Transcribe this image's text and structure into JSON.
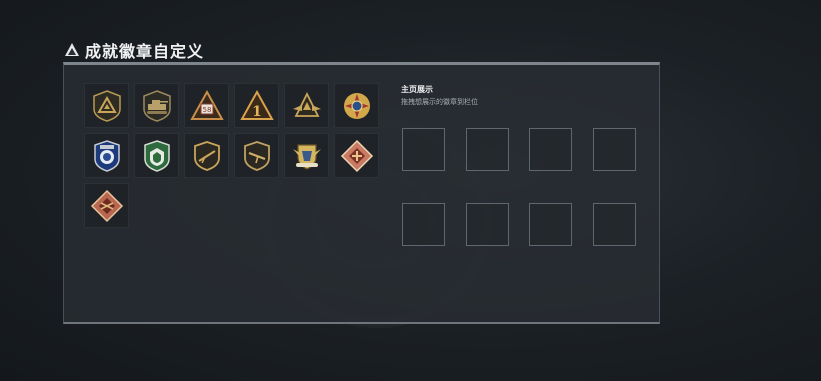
{
  "header": {
    "title": "成就徽章自定义",
    "icon": "triangle-logo-icon"
  },
  "showcase": {
    "title": "主页展示",
    "subtitle": "拖拽想展示的徽章到栏位",
    "slots": 8
  },
  "badges": [
    {
      "name": "badge-shield-triangle",
      "icon": "shield-triangle-icon"
    },
    {
      "name": "badge-tank",
      "icon": "tank-icon"
    },
    {
      "name": "badge-triangle-58",
      "icon": "triangle-58-icon",
      "label": "58"
    },
    {
      "name": "badge-triangle-1",
      "icon": "triangle-1-icon",
      "label": "1"
    },
    {
      "name": "badge-winged-triangle",
      "icon": "winged-triangle-icon"
    },
    {
      "name": "badge-red-cross-medal",
      "icon": "cross-medal-icon"
    },
    {
      "name": "badge-blue-police",
      "icon": "police-badge-icon"
    },
    {
      "name": "badge-green-shield",
      "icon": "green-shield-icon"
    },
    {
      "name": "badge-rifle-shield-1",
      "icon": "rifle-shield-icon"
    },
    {
      "name": "badge-rifle-shield-2",
      "icon": "rifle-shield-icon"
    },
    {
      "name": "badge-eagle-crest",
      "icon": "eagle-crest-icon"
    },
    {
      "name": "badge-diamond-emblem-1",
      "icon": "diamond-emblem-icon"
    },
    {
      "name": "badge-diamond-emblem-2",
      "icon": "diamond-emblem-icon"
    }
  ],
  "colors": {
    "gold": "#c9a65a",
    "panel": "#282d33",
    "slot_border": "#5f666d"
  }
}
